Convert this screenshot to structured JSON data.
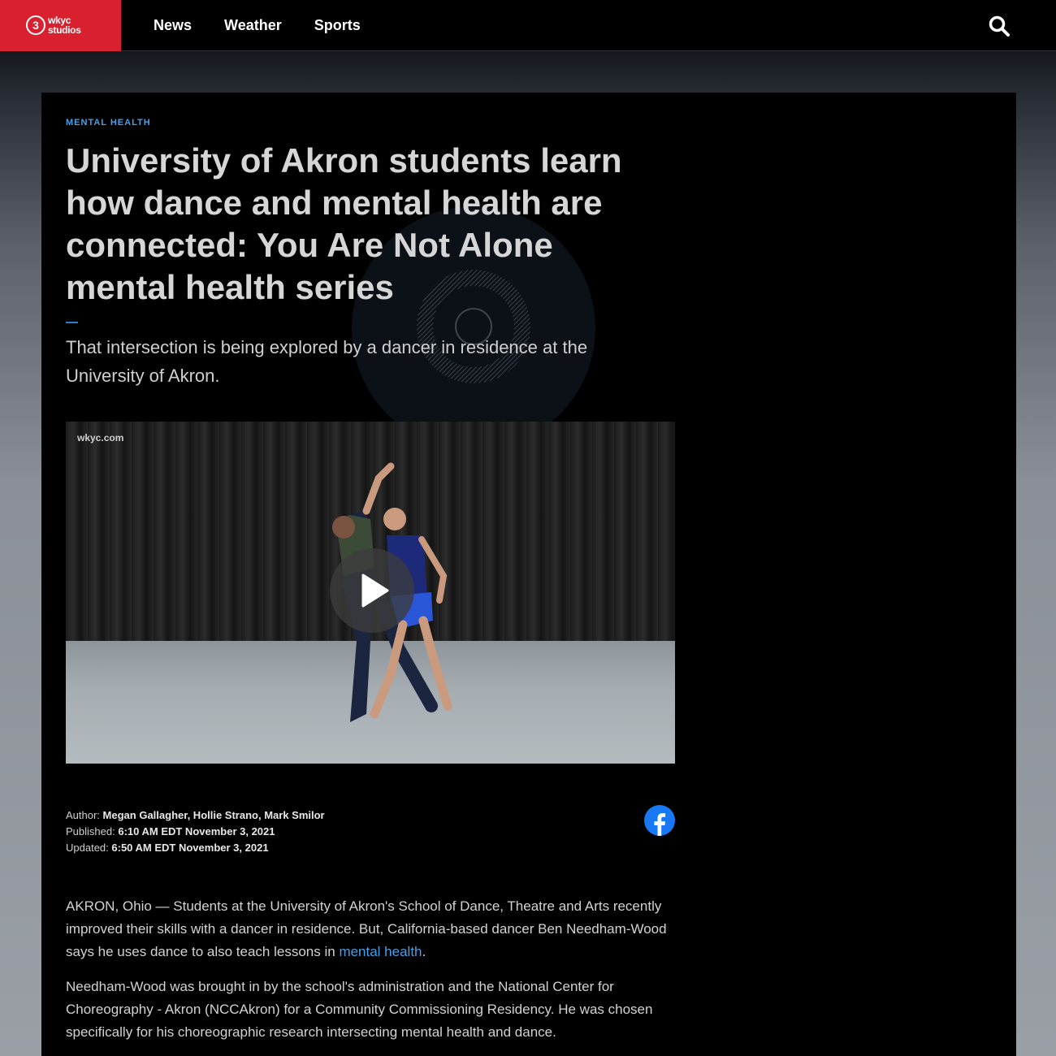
{
  "header": {
    "logo": {
      "number": "3",
      "line1": "wkyc",
      "line2": "studios"
    },
    "nav": [
      {
        "label": "News"
      },
      {
        "label": "Weather"
      },
      {
        "label": "Sports"
      }
    ],
    "icons": {
      "search": "search-icon"
    }
  },
  "article": {
    "category": "MENTAL HEALTH",
    "headline": "University of Akron students learn how dance and mental health are connected: You Are Not Alone mental health series",
    "summary": "That intersection is being explored by a dancer in residence at the University of Akron.",
    "video": {
      "watermark": "wkyc.com",
      "play_icon": "play-icon"
    },
    "byline": {
      "author_label": "Author:",
      "authors": "Megan Gallagher, Hollie Strano, Mark Smilor",
      "published_label": "Published:",
      "published": "6:10 AM EDT November 3, 2021",
      "updated_label": "Updated:",
      "updated": "6:50 AM EDT November 3, 2021"
    },
    "share": {
      "facebook_icon": "facebook-icon"
    },
    "paragraphs": [
      {
        "before": "AKRON, Ohio — Students at the University of Akron's School of Dance, Theatre and Arts recently improved their skills with a dancer in residence. But, California-based dancer Ben Needham-Wood says he uses dance to also teach lessons in ",
        "link": "mental health",
        "after": "."
      },
      {
        "text": "Needham-Wood was brought in by the school's administration and the National Center for Choreography - Akron (NCCAkron) for a Community Commissioning Residency. He was chosen specifically for his choreographic research intersecting mental health and dance."
      }
    ]
  },
  "colors": {
    "brand_red": "#d9202e",
    "link_blue": "#4a9fe8",
    "facebook_blue": "#1877f2"
  }
}
